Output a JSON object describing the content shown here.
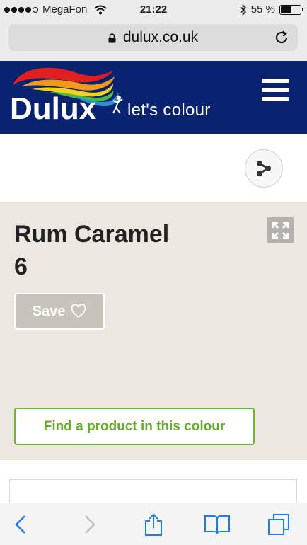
{
  "status_bar": {
    "carrier": "MegaFon",
    "time": "21:22",
    "battery_text": "55 %",
    "battery_level": 0.55,
    "signal_bars_filled": 4,
    "signal_bars_total": 5
  },
  "browser": {
    "url": "dulux.co.uk"
  },
  "header": {
    "brand": "Dulux",
    "tagline": "let's colour",
    "background_color": "#0a2370"
  },
  "colour": {
    "name": "Rum Caramel",
    "code": "6",
    "swatch_color": "#ede7e1"
  },
  "actions": {
    "save_label": "Save",
    "find_product_label": "Find a product in this colour",
    "accent_green": "#71b43d"
  },
  "icons": {
    "share": "share-icon",
    "expand": "expand-icon",
    "heart": "heart-icon",
    "menu": "hamburger-menu-icon",
    "back": "back-arrow-icon",
    "forward": "forward-arrow-icon",
    "share_sheet": "share-sheet-icon",
    "bookmarks": "bookmarks-icon",
    "tabs": "tabs-icon"
  }
}
